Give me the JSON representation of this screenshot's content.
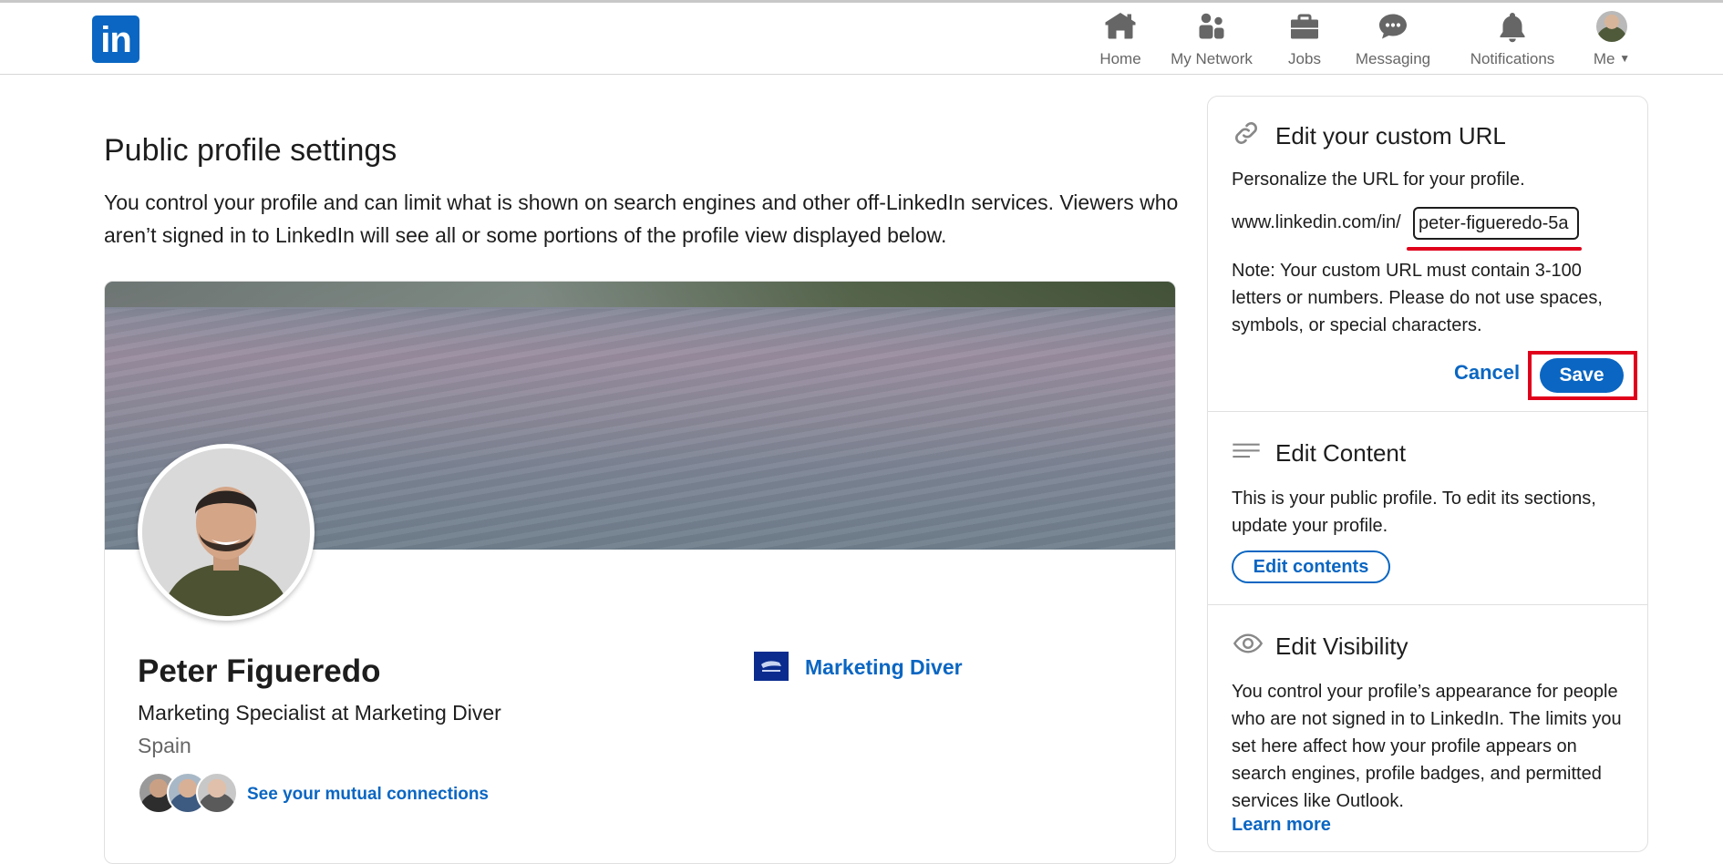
{
  "nav": {
    "logo_text": "in",
    "items": [
      {
        "label": "Home",
        "icon": "home-icon"
      },
      {
        "label": "My Network",
        "icon": "network-icon"
      },
      {
        "label": "Jobs",
        "icon": "briefcase-icon"
      },
      {
        "label": "Messaging",
        "icon": "messaging-icon"
      },
      {
        "label": "Notifications",
        "icon": "bell-icon"
      },
      {
        "label": "Me",
        "icon": "avatar"
      }
    ]
  },
  "main": {
    "title": "Public profile settings",
    "description": "You control your profile and can limit what is shown on search engines and other off-LinkedIn services. Viewers who aren’t signed in to LinkedIn will see all or some portions of the profile view displayed below."
  },
  "profile": {
    "name": "Peter Figueredo",
    "headline": "Marketing Specialist at Marketing Diver",
    "location": "Spain",
    "mutual_link": "See your mutual connections",
    "company": "Marketing Diver"
  },
  "side": {
    "url_section": {
      "title": "Edit your custom URL",
      "subtitle": "Personalize the URL for your profile.",
      "prefix": "www.linkedin.com/in/",
      "value": "peter-figueredo-5a",
      "note": "Note: Your custom URL must contain 3-100 letters or numbers. Please do not use spaces, symbols, or special characters.",
      "cancel_label": "Cancel",
      "save_label": "Save"
    },
    "content_section": {
      "title": "Edit Content",
      "text": "This is your public profile. To edit its sections, update your profile.",
      "button_label": "Edit contents"
    },
    "visibility_section": {
      "title": "Edit Visibility",
      "text": "You control your profile’s appearance for people who are not signed in to LinkedIn. The limits you set here affect how your profile appears on search engines, profile badges, and permitted services like Outlook.",
      "learn_more": "Learn more"
    }
  },
  "colors": {
    "brand": "#0a66c2",
    "highlight": "#e0001b"
  }
}
